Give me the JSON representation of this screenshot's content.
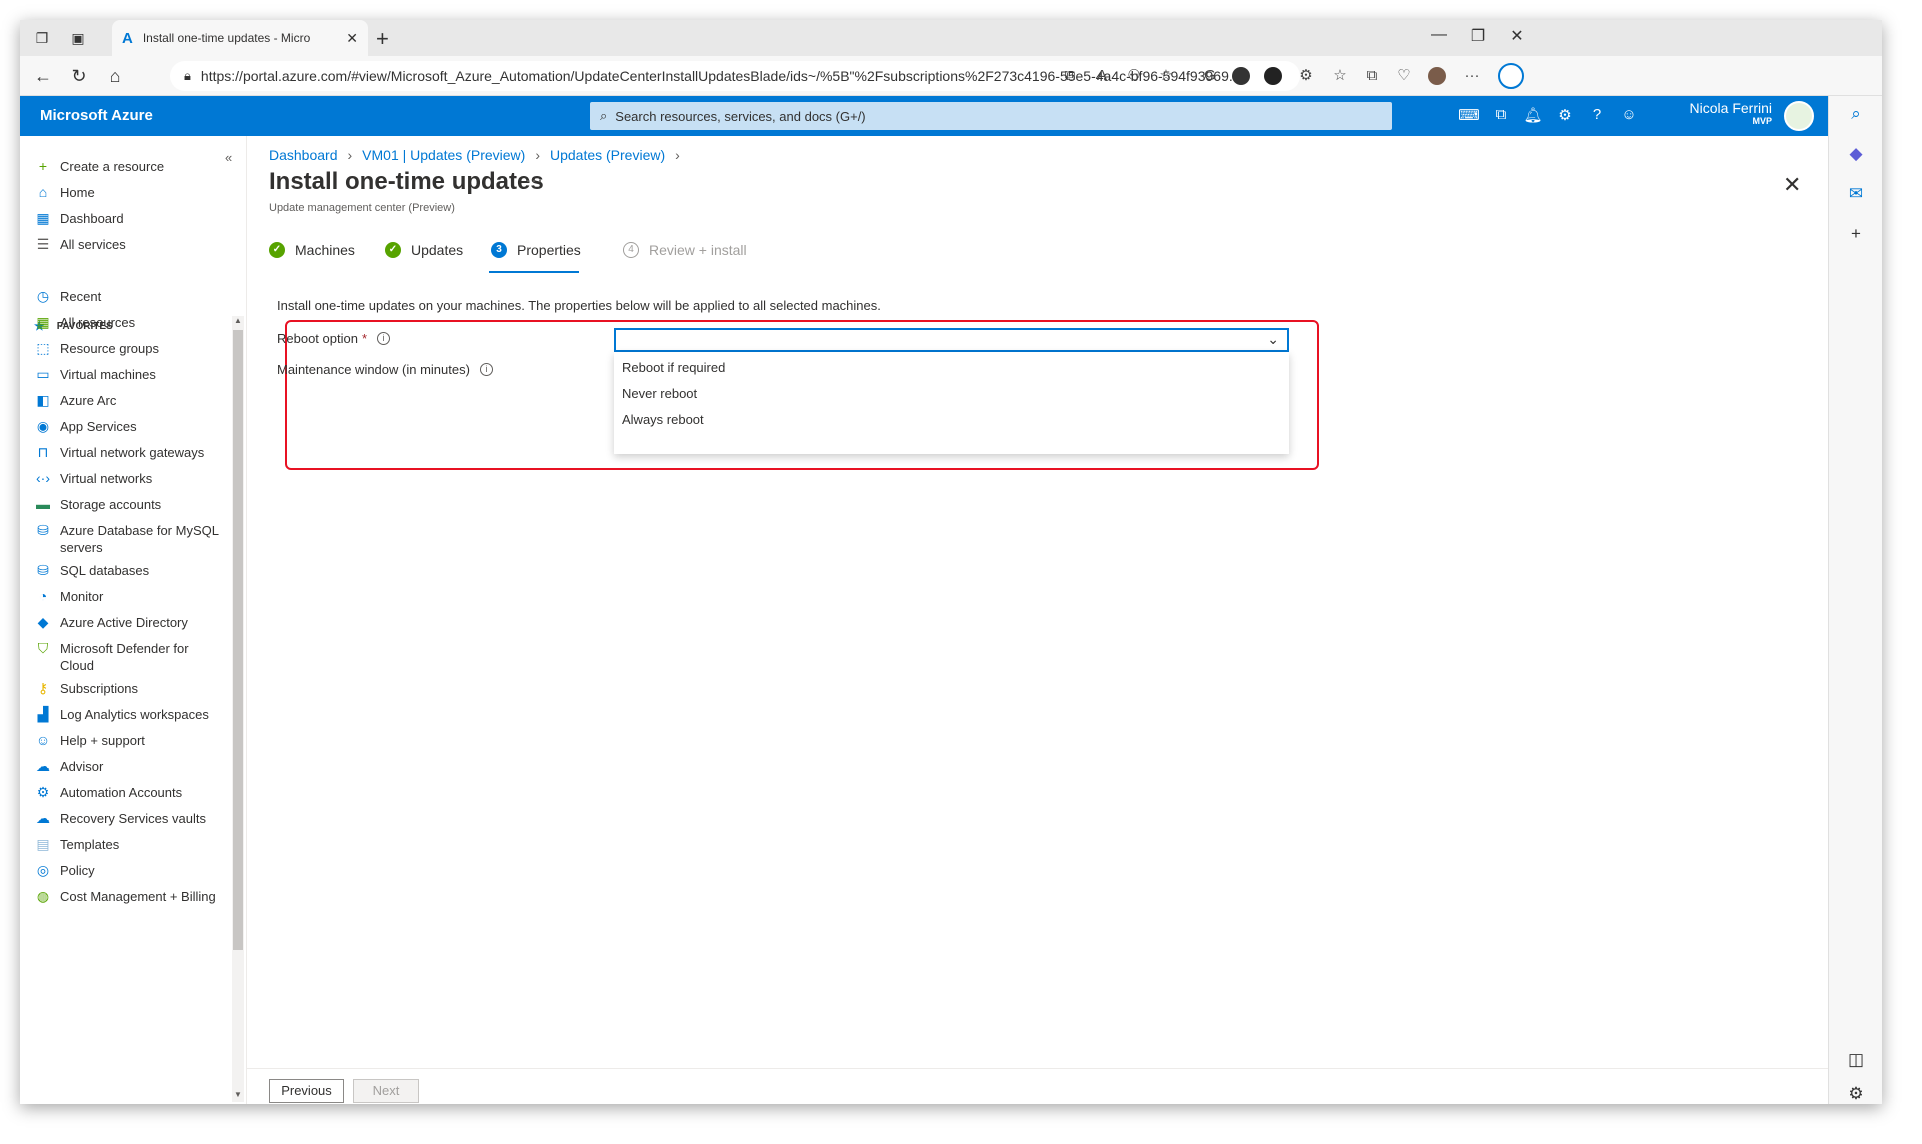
{
  "browser": {
    "tab_title": "Install one-time updates - Micro",
    "url": "https://portal.azure.com/#view/Microsoft_Azure_Automation/UpdateCenterInstallUpdatesBlade/ids~/%5B\"%2Fsubscriptions%2F273c4196-55e5-4a4c-bf96-594f93969..."
  },
  "header": {
    "brand": "Microsoft Azure",
    "search_placeholder": "Search resources, services, and docs (G+/)",
    "user_name": "Nicola Ferrini",
    "user_role": "MVP"
  },
  "nav": {
    "top_items": [
      {
        "label": "Create a resource",
        "icon": "plus-icon"
      },
      {
        "label": "Home",
        "icon": "home-icon"
      },
      {
        "label": "Dashboard",
        "icon": "dashboard-icon"
      },
      {
        "label": "All services",
        "icon": "list-icon"
      }
    ],
    "favorites_label": "FAVORITES",
    "items": [
      {
        "label": "Recent",
        "icon": "clock-icon"
      },
      {
        "label": "All resources",
        "icon": "grid-icon"
      },
      {
        "label": "Resource groups",
        "icon": "resource-group-icon"
      },
      {
        "label": "Virtual machines",
        "icon": "vm-icon"
      },
      {
        "label": "Azure Arc",
        "icon": "arc-icon"
      },
      {
        "label": "App Services",
        "icon": "app-service-icon"
      },
      {
        "label": "Virtual network gateways",
        "icon": "lock-icon"
      },
      {
        "label": "Virtual networks",
        "icon": "vnet-icon"
      },
      {
        "label": "Storage accounts",
        "icon": "storage-icon"
      },
      {
        "label": "Azure Database for MySQL servers",
        "icon": "database-icon"
      },
      {
        "label": "SQL databases",
        "icon": "sql-icon"
      },
      {
        "label": "Monitor",
        "icon": "monitor-icon"
      },
      {
        "label": "Azure Active Directory",
        "icon": "aad-icon"
      },
      {
        "label": "Microsoft Defender for Cloud",
        "icon": "shield-icon"
      },
      {
        "label": "Subscriptions",
        "icon": "key-icon"
      },
      {
        "label": "Log Analytics workspaces",
        "icon": "analytics-icon"
      },
      {
        "label": "Help + support",
        "icon": "help-icon"
      },
      {
        "label": "Advisor",
        "icon": "advisor-icon"
      },
      {
        "label": "Automation Accounts",
        "icon": "gear-icon"
      },
      {
        "label": "Recovery Services vaults",
        "icon": "cloud-icon"
      },
      {
        "label": "Templates",
        "icon": "template-icon"
      },
      {
        "label": "Policy",
        "icon": "policy-icon"
      },
      {
        "label": "Cost Management + Billing",
        "icon": "cost-icon"
      }
    ]
  },
  "breadcrumb": [
    "Dashboard",
    "VM01 | Updates (Preview)",
    "Updates (Preview)"
  ],
  "page": {
    "title": "Install one-time updates",
    "subtitle": "Update management center (Preview)",
    "more": "···"
  },
  "steps": [
    {
      "label": "Machines",
      "state": "done"
    },
    {
      "label": "Updates",
      "state": "done"
    },
    {
      "label": "Properties",
      "state": "current",
      "num": "3"
    },
    {
      "label": "Review + install",
      "state": "todo",
      "num": "4"
    }
  ],
  "form": {
    "intro": "Install one-time updates on your machines. The properties below will be applied to all selected machines.",
    "reboot_label": "Reboot option",
    "required_mark": "*",
    "maintenance_label": "Maintenance window (in minutes)",
    "reboot_value": "",
    "reboot_options": [
      "Reboot if required",
      "Never reboot",
      "Always reboot"
    ]
  },
  "footer": {
    "previous": "Previous",
    "next": "Next"
  },
  "colors": {
    "azure_blue": "#0078d4",
    "highlight_red": "#e81123",
    "done_green": "#57a300"
  }
}
